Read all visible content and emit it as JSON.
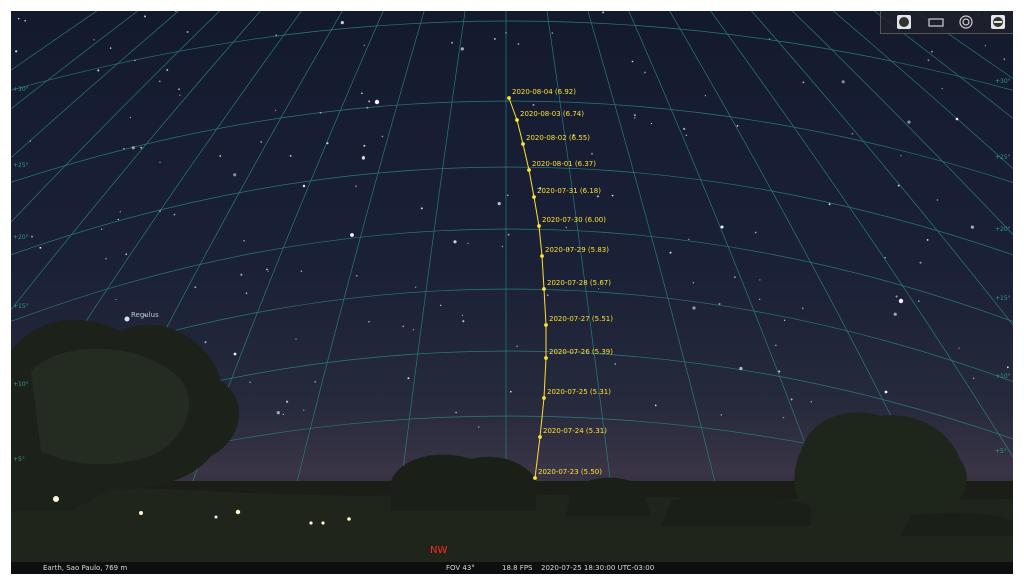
{
  "toolbar": {
    "buttons": [
      {
        "name": "ground-toggle-icon"
      },
      {
        "name": "window-mode-icon"
      },
      {
        "name": "target-icon"
      },
      {
        "name": "no-entry-icon"
      }
    ]
  },
  "sky": {
    "star_label": "Regulus",
    "cardinal": "NW",
    "alt_labels": [
      "+5°",
      "+10°",
      "+15°",
      "+20°",
      "+25°",
      "+30°"
    ],
    "track_color": "#ffe033",
    "track_points": [
      {
        "label": "2020-08-04 (6.92)"
      },
      {
        "label": "2020-08-03 (6.74)"
      },
      {
        "label": "2020-08-02 (6.55)"
      },
      {
        "label": "2020-08-01 (6.37)"
      },
      {
        "label": "2020-07-31 (6.18)"
      },
      {
        "label": "2020-07-30 (6.00)"
      },
      {
        "label": "2020-07-29 (5.83)"
      },
      {
        "label": "2020-07-28 (5.67)"
      },
      {
        "label": "2020-07-27 (5.51)"
      },
      {
        "label": "2020-07-26 (5.39)"
      },
      {
        "label": "2020-07-25 (5.31)"
      },
      {
        "label": "2020-07-24 (5.31)"
      },
      {
        "label": "2020-07-23 (5.50)"
      }
    ]
  },
  "status": {
    "location": "Earth, Sao Paulo, 769 m",
    "fov": "FOV 43°",
    "fps": "18.8 FPS",
    "datetime": "2020-07-25 18:30:00 UTC-03:00"
  }
}
